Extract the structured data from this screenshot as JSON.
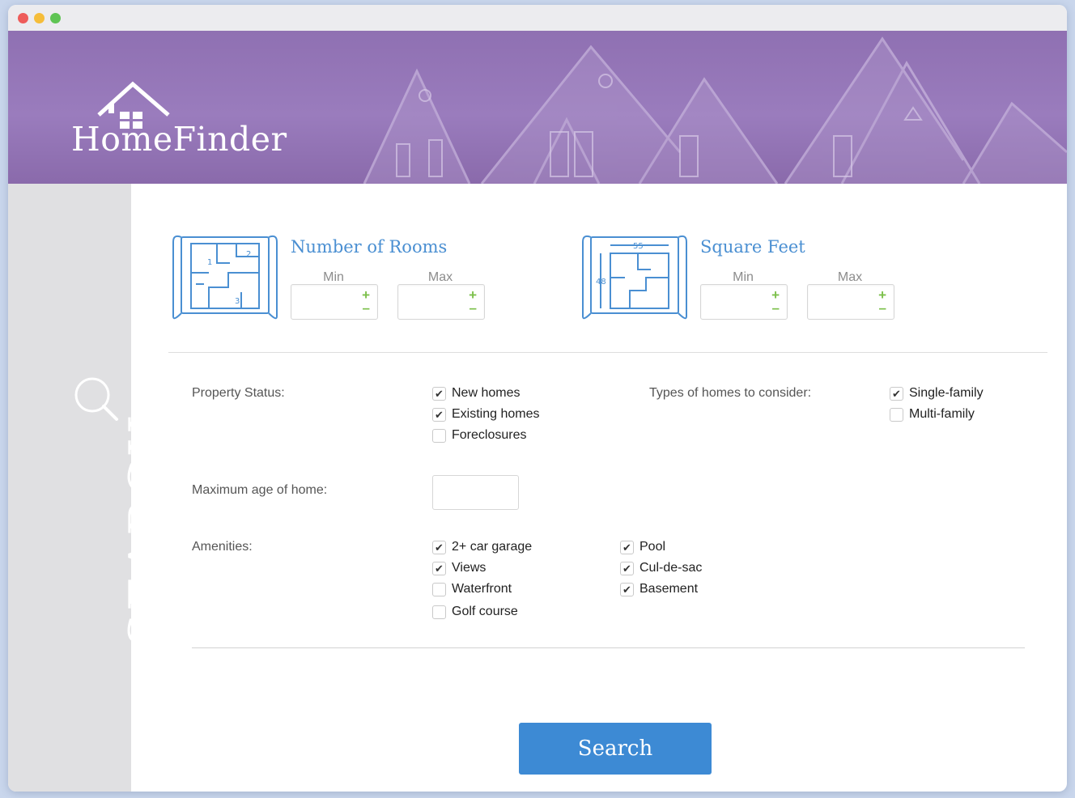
{
  "app": {
    "name": "HomeFinder"
  },
  "sidebar": {
    "label": "SEARCH"
  },
  "rooms": {
    "title": "Number of Rooms",
    "min_label": "Min",
    "max_label": "Max",
    "min_value": "",
    "max_value": ""
  },
  "square_feet": {
    "title": "Square Feet",
    "min_label": "Min",
    "max_label": "Max",
    "min_value": "",
    "max_value": ""
  },
  "blueprints": {
    "rooms_numbers": [
      "1",
      "2",
      "3"
    ],
    "sqft_width": "55",
    "sqft_height": "48"
  },
  "stepper": {
    "plus": "+",
    "minus": "–"
  },
  "property_status": {
    "label": "Property Status:",
    "options": [
      {
        "label": "New homes",
        "checked": true
      },
      {
        "label": "Existing homes",
        "checked": true
      },
      {
        "label": "Foreclosures",
        "checked": false
      }
    ]
  },
  "home_types": {
    "label": "Types of homes to consider:",
    "options": [
      {
        "label": "Single-family",
        "checked": true
      },
      {
        "label": "Multi-family",
        "checked": false
      }
    ]
  },
  "max_age": {
    "label": "Maximum age of home:",
    "value": ""
  },
  "amenities": {
    "label": "Amenities:",
    "options": [
      {
        "label": "2+ car garage",
        "checked": true
      },
      {
        "label": "Views",
        "checked": true
      },
      {
        "label": "Waterfront",
        "checked": false
      },
      {
        "label": "Golf course",
        "checked": false
      },
      {
        "label": "Pool",
        "checked": true
      },
      {
        "label": "Cul-de-sac",
        "checked": true
      },
      {
        "label": "Basement",
        "checked": true
      }
    ]
  },
  "search_button": {
    "label": "Search"
  },
  "colors": {
    "banner_purple": "#9a7cbd",
    "accent_blue": "#3d8ad4",
    "title_blue": "#4a8fd2",
    "stepper_green": "#7cc04b",
    "sidebar_gray": "#e0e0e2"
  }
}
